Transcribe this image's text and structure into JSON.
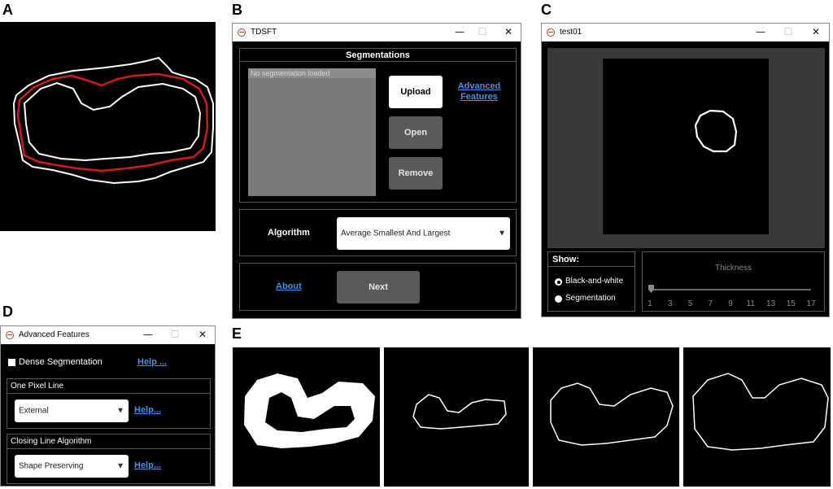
{
  "panel_labels": {
    "a": "A",
    "b": "B",
    "c": "C",
    "d": "D",
    "e": "E"
  },
  "window_b": {
    "title": "TDSFT",
    "controls": {
      "minimize": "—",
      "maximize": "☐",
      "close": "✕"
    },
    "segmentations_header": "Segmentations",
    "list_placeholder": "No segmentation loaded",
    "upload_label": "Upload",
    "open_label": "Open",
    "remove_label": "Remove",
    "advanced_features_line1": "Advanced",
    "advanced_features_line2": "Features",
    "algorithm_label": "Algorithm",
    "algorithm_value": "Average Smallest And Largest",
    "about_label": "About",
    "next_label": "Next"
  },
  "window_c": {
    "title": "test01",
    "controls": {
      "minimize": "—",
      "maximize": "☐",
      "close": "✕"
    },
    "show_label": "Show:",
    "option_bw": "Black-and-white",
    "option_seg": "Segmentation",
    "thickness_label": "Thickness",
    "slider_ticks": [
      "1",
      "3",
      "5",
      "7",
      "9",
      "11",
      "13",
      "15",
      "17"
    ],
    "slider_value": 1
  },
  "window_d": {
    "title": "Advanced Features",
    "controls": {
      "minimize": "—",
      "maximize": "☐",
      "close": "✕"
    },
    "dense_label": "Dense Segmentation",
    "help1": "Help ...",
    "one_pixel_label": "One Pixel Line",
    "one_pixel_value": "External",
    "help2": "Help...",
    "closing_label": "Closing Line Algorithm",
    "closing_value": "Shape Preserving",
    "help3": "Help..."
  },
  "colors": {
    "contour": "#ffffff",
    "average": "#d21a1a",
    "link": "#4a90e2",
    "window_bg": "#000000"
  }
}
